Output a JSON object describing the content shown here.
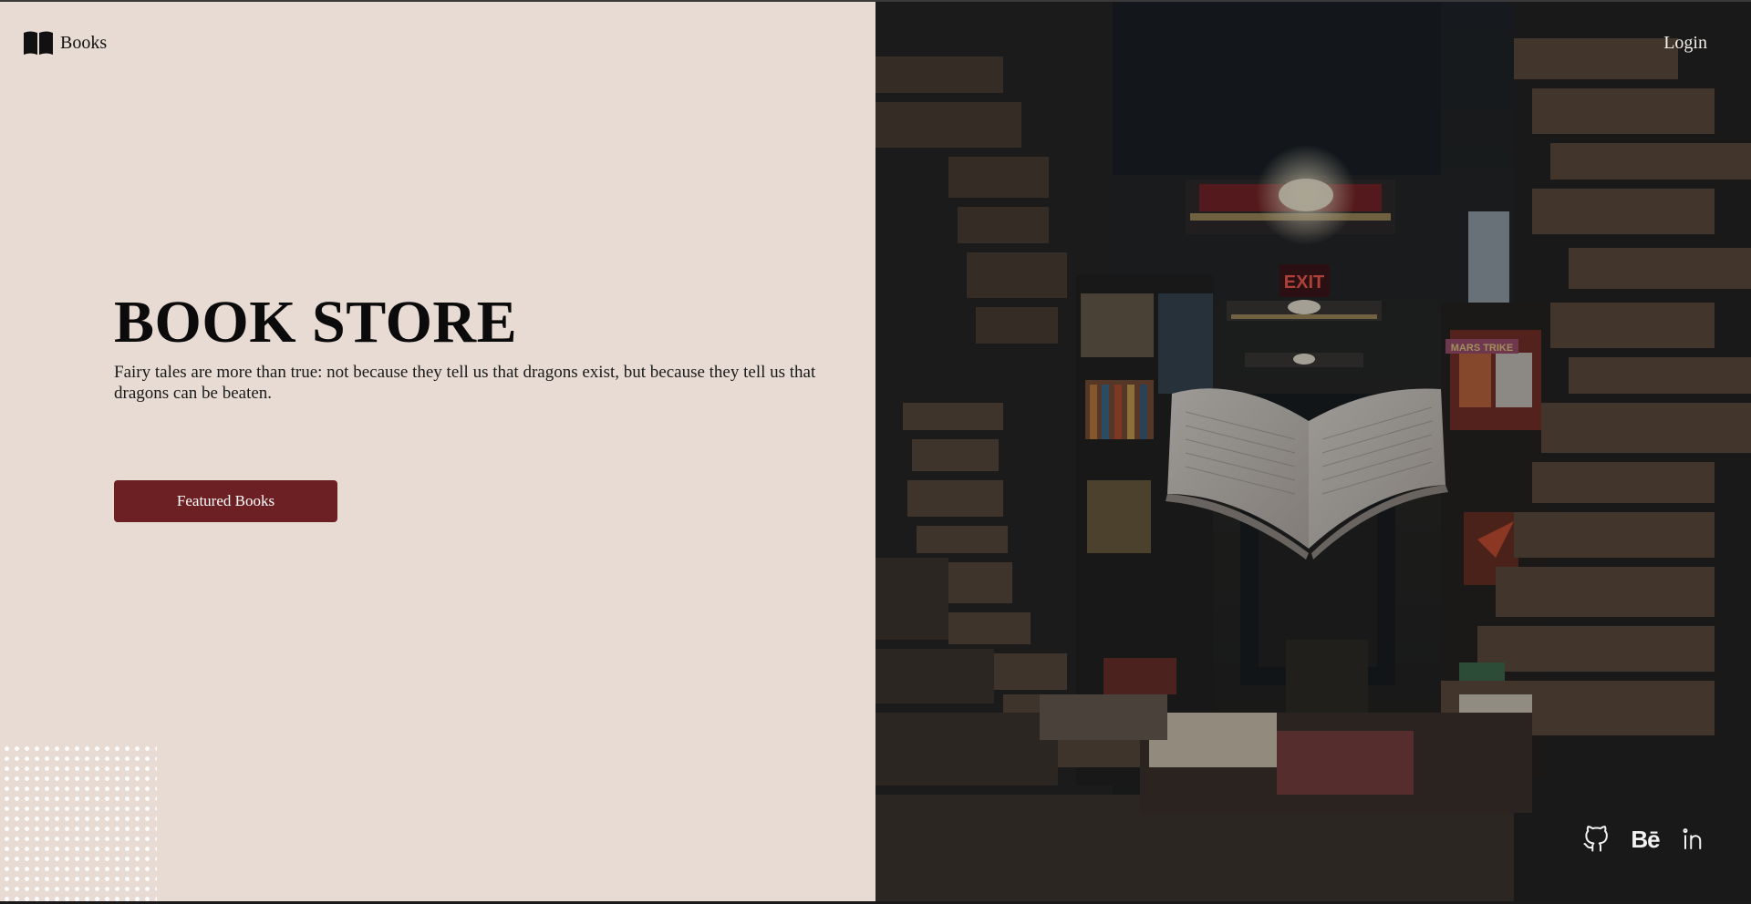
{
  "brand": {
    "name": "Books",
    "icon": "open-book-icon"
  },
  "nav": {
    "login_label": "Login"
  },
  "hero": {
    "title": "BOOK STORE",
    "tagline": "Fairy tales are more than true: not because they tell us that dragons exist, but because they tell us that dragons can be beaten.",
    "cta_label": "Featured Books"
  },
  "hero_image": {
    "exit_sign": "EXIT",
    "shelf_label": "MARS TRIKE"
  },
  "social": {
    "behance_label": "Bē",
    "items": [
      "github-icon",
      "behance-icon",
      "linkedin-icon"
    ]
  },
  "colors": {
    "left_bg": "#e7dbd3",
    "accent": "#6d2023",
    "right_bg": "#1c2024",
    "text_dark": "#0b0b0b"
  }
}
